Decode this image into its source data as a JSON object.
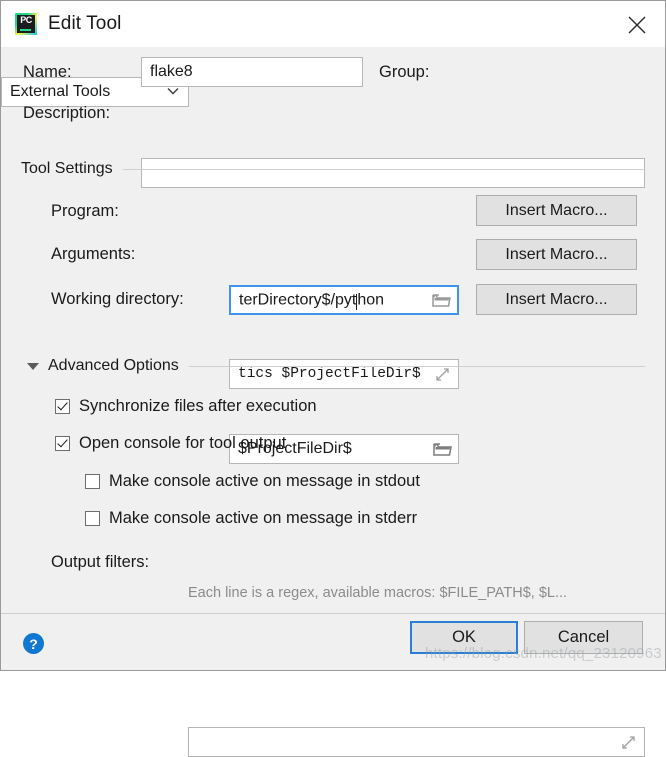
{
  "window": {
    "title": "Edit Tool",
    "app_icon": "pycharm-icon",
    "app_icon_text": "PC",
    "close_icon": "close-icon"
  },
  "form": {
    "name_label": "Name:",
    "name_value": "flake8",
    "group_label": "Group:",
    "group_value": "External Tools",
    "group_options": [
      "External Tools"
    ],
    "description_label": "Description:",
    "description_value": "",
    "description_placeholder": ""
  },
  "tool_settings": {
    "title": "Tool Settings",
    "program_label": "Program:",
    "program_value": "terDirectory$/pyt",
    "program_value_tail": "hon",
    "program_browse_icon": "folder-icon",
    "arguments_label": "Arguments:",
    "arguments_value": "tics $ProjectFileDir$",
    "arguments_expand_icon": "expand-icon",
    "working_directory_label": "Working directory:",
    "working_directory_value": "$ProjectFileDir$",
    "working_directory_browse_icon": "folder-icon",
    "insert_macro_label": "Insert Macro..."
  },
  "advanced": {
    "title": "Advanced Options",
    "toggle_icon": "triangle-down-icon",
    "checkboxes": [
      {
        "label": "Synchronize files after execution",
        "checked": true,
        "indent": 0
      },
      {
        "label": "Open console for tool output",
        "checked": true,
        "indent": 0
      },
      {
        "label": "Make console active on message in stdout",
        "checked": false,
        "indent": 1
      },
      {
        "label": "Make console active on message in stderr",
        "checked": false,
        "indent": 1
      }
    ],
    "output_filters_label": "Output filters:",
    "output_filters_value": "",
    "output_filters_expand_icon": "expand-icon",
    "output_filters_hint": "Each line is a regex, available macros: $FILE_PATH$, $L..."
  },
  "footer": {
    "help_icon": "help-icon",
    "help_label": "?",
    "ok_label": "OK",
    "cancel_label": "Cancel"
  },
  "watermark": "https://blog.csdn.net/qq_23120963",
  "colors": {
    "accent": "#3d94e8",
    "focus_border": "#2a7fd4",
    "dialog_bg": "#f0f0f0",
    "field_bg": "#ffffff",
    "help_blue": "#1177d1"
  }
}
